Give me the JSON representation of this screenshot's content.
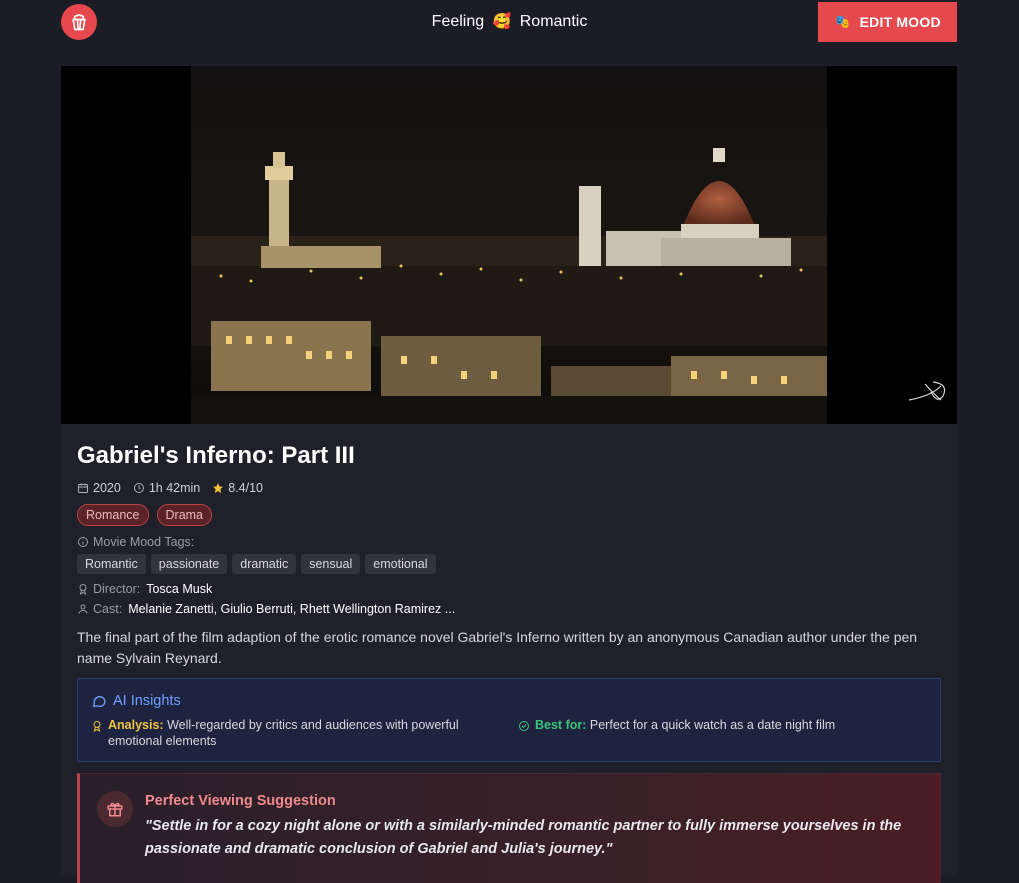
{
  "header": {
    "mood_prefix": "Feeling",
    "mood_emoji": "🥰",
    "mood_name": "Romantic",
    "edit_label": "EDIT MOOD",
    "edit_emoji": "🎭"
  },
  "movie": {
    "title": "Gabriel's Inferno: Part III",
    "year": "2020",
    "duration": "1h 42min",
    "rating": "8.4/10",
    "genres": [
      "Romance",
      "Drama"
    ],
    "mood_tags_label": "Movie Mood Tags:",
    "mood_tags": [
      "Romantic",
      "passionate",
      "dramatic",
      "sensual",
      "emotional"
    ],
    "director_label": "Director:",
    "director": "Tosca Musk",
    "cast_label": "Cast:",
    "cast": "Melanie Zanetti, Giulio Berruti, Rhett Wellington Ramirez ...",
    "description": "The final part of the film adaption of the erotic romance novel Gabriel's Inferno written by an anonymous Canadian author under the pen name Sylvain Reynard."
  },
  "insights": {
    "title": "AI Insights",
    "analysis_label": "Analysis:",
    "analysis_text": "Well-regarded by critics and audiences with powerful emotional elements",
    "best_label": "Best for:",
    "best_text": "Perfect for a quick watch as a date night film"
  },
  "suggestion": {
    "title": "Perfect Viewing Suggestion",
    "text": "\"Settle in for a cozy night alone or with a similarly-minded romantic partner to fully immerse yourselves in the passionate and dramatic conclusion of Gabriel and Julia's journey.\""
  },
  "colors": {
    "accent": "#e5484d",
    "background": "#1c1c26",
    "card": "#20202b",
    "insight_blue": "#6ea0ff",
    "analysis_yellow": "#f0c43c",
    "best_green": "#3cc37a"
  },
  "icons": {
    "logo": "popcorn-icon",
    "edit": "theater-masks-icon",
    "year": "calendar-icon",
    "duration": "clock-icon",
    "rating": "star-icon",
    "mood_tags": "info-icon",
    "director": "award-icon",
    "cast": "user-icon",
    "insights": "chat-bubble-icon",
    "analysis": "award-icon",
    "best_for": "check-circle-icon",
    "suggestion": "gift-icon"
  }
}
